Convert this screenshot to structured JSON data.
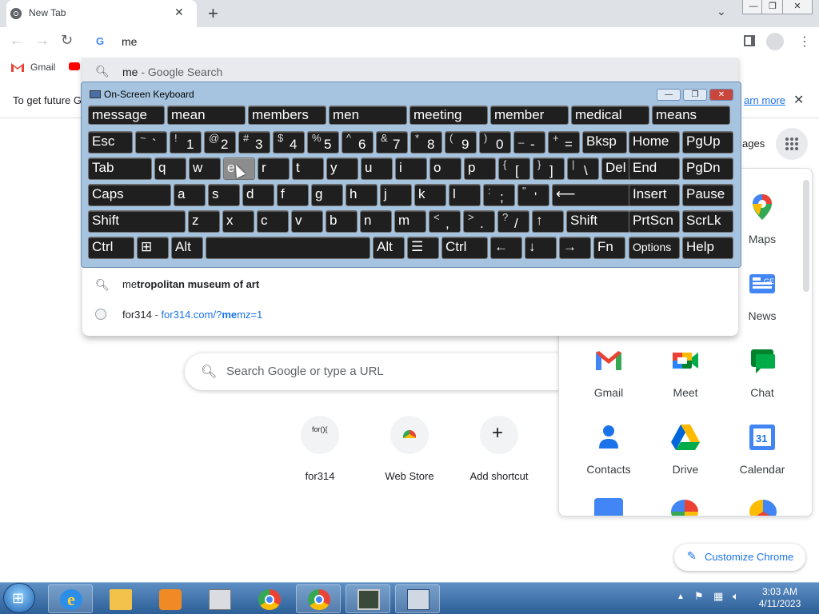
{
  "browser": {
    "tab_title": "New Tab",
    "tab_close": "✕",
    "new_tab": "+",
    "omnibox_value": "me",
    "bookmark_gmail": "Gmail"
  },
  "window_controls": {
    "minimize": "—",
    "restore": "❐",
    "close": "✕"
  },
  "infobar": {
    "text": "To get future G",
    "learn_more": "arn more",
    "close": "✕"
  },
  "dropdown": {
    "top_suggestion": "me",
    "top_suggestion_suffix": " - Google Search",
    "suggestions": [
      {
        "prefix": "me",
        "rest": "tropolitan museum of art"
      },
      {
        "site": "for314",
        "sep": " - ",
        "url_pre": "for314.com/?",
        "url_bold": "me",
        "url_post": "mz=1"
      }
    ]
  },
  "osk": {
    "title": "On-Screen Keyboard",
    "predictions": [
      "message",
      "mean",
      "members",
      "men",
      "meeting",
      "member",
      "medical",
      "means"
    ],
    "rows": [
      [
        {
          "l": "Esc",
          "w": 56
        },
        {
          "s": "~",
          "m": "`",
          "w": 40
        },
        {
          "s": "!",
          "m": "1",
          "w": 40
        },
        {
          "s": "@",
          "m": "2",
          "w": 40
        },
        {
          "s": "#",
          "m": "3",
          "w": 40
        },
        {
          "s": "$",
          "m": "4",
          "w": 40
        },
        {
          "s": "%",
          "m": "5",
          "w": 40
        },
        {
          "s": "^",
          "m": "6",
          "w": 40
        },
        {
          "s": "&",
          "m": "7",
          "w": 40
        },
        {
          "s": "*",
          "m": "8",
          "w": 40
        },
        {
          "s": "(",
          "m": "9",
          "w": 40
        },
        {
          "s": ")",
          "m": "0",
          "w": 40
        },
        {
          "s": "_",
          "m": "-",
          "w": 40
        },
        {
          "s": "+",
          "m": "=",
          "w": 40
        },
        {
          "l": "Bksp",
          "w": 56
        },
        {
          "l": "Home",
          "w": 64
        },
        {
          "l": "PgUp",
          "w": 64
        }
      ],
      [
        {
          "l": "Tab",
          "w": 80
        },
        {
          "l": "q",
          "w": 40
        },
        {
          "l": "w",
          "w": 40
        },
        {
          "l": "e",
          "w": 40,
          "hover": true
        },
        {
          "l": "r",
          "w": 40
        },
        {
          "l": "t",
          "w": 40
        },
        {
          "l": "y",
          "w": 40
        },
        {
          "l": "u",
          "w": 40
        },
        {
          "l": "i",
          "w": 40
        },
        {
          "l": "o",
          "w": 40
        },
        {
          "l": "p",
          "w": 40
        },
        {
          "s": "{",
          "m": "[",
          "w": 40
        },
        {
          "s": "}",
          "m": "]",
          "w": 40
        },
        {
          "s": "|",
          "m": "\\",
          "w": 40
        },
        {
          "l": "Del",
          "w": 40
        },
        {
          "l": "End",
          "w": 64
        },
        {
          "l": "PgDn",
          "w": 64
        }
      ],
      [
        {
          "l": "Caps",
          "w": 104
        },
        {
          "l": "a",
          "w": 40
        },
        {
          "l": "s",
          "w": 40
        },
        {
          "l": "d",
          "w": 40
        },
        {
          "l": "f",
          "w": 40
        },
        {
          "l": "g",
          "w": 40
        },
        {
          "l": "h",
          "w": 40
        },
        {
          "l": "j",
          "w": 40
        },
        {
          "l": "k",
          "w": 40
        },
        {
          "l": "l",
          "w": 40
        },
        {
          "s": ":",
          "m": ";",
          "w": 40
        },
        {
          "s": "\"",
          "m": "'",
          "w": 40
        },
        {
          "l": "⟵",
          "w": 104
        },
        {
          "l": "Insert",
          "w": 64
        },
        {
          "l": "Pause",
          "w": 64
        }
      ],
      [
        {
          "l": "Shift",
          "w": 122
        },
        {
          "l": "z",
          "w": 40
        },
        {
          "l": "x",
          "w": 40
        },
        {
          "l": "c",
          "w": 40
        },
        {
          "l": "v",
          "w": 40
        },
        {
          "l": "b",
          "w": 40
        },
        {
          "l": "n",
          "w": 40
        },
        {
          "l": "m",
          "w": 40
        },
        {
          "s": "<",
          "m": ",",
          "w": 40
        },
        {
          "s": ">",
          "m": ".",
          "w": 40
        },
        {
          "s": "?",
          "m": "/",
          "w": 40
        },
        {
          "l": "↑",
          "w": 40
        },
        {
          "l": "Shift",
          "w": 80
        },
        {
          "l": "PrtScn",
          "w": 64
        },
        {
          "l": "ScrLk",
          "w": 64
        }
      ],
      [
        {
          "l": "Ctrl",
          "w": 58
        },
        {
          "l": "⊞",
          "w": 40
        },
        {
          "l": "Alt",
          "w": 40
        },
        {
          "l": "",
          "w": 206
        },
        {
          "l": "Alt",
          "w": 40
        },
        {
          "l": "☰",
          "w": 40
        },
        {
          "l": "Ctrl",
          "w": 58
        },
        {
          "l": "←",
          "w": 40
        },
        {
          "l": "↓",
          "w": 40
        },
        {
          "l": "→",
          "w": 40
        },
        {
          "l": "Fn",
          "w": 40
        },
        {
          "l": "Options",
          "w": 64,
          "small": true
        },
        {
          "l": "Help",
          "w": 64
        }
      ]
    ]
  },
  "ntp": {
    "search_placeholder": "Search Google or type a URL",
    "images_label": "ages",
    "shortcuts": [
      {
        "label": "for314",
        "icon": "for(){"
      },
      {
        "label": "Web Store",
        "icon": ""
      },
      {
        "label": "Add shortcut",
        "icon": "+"
      }
    ],
    "customize": "Customize Chrome"
  },
  "apps": [
    {
      "label": "Maps",
      "icon": "maps-icon"
    },
    {
      "label": "News",
      "icon": "news-icon"
    },
    {
      "label": "Gmail",
      "icon": "gmail-icon"
    },
    {
      "label": "Meet",
      "icon": "meet-icon"
    },
    {
      "label": "Chat",
      "icon": "chat-icon"
    },
    {
      "label": "Contacts",
      "icon": "contacts-icon"
    },
    {
      "label": "Drive",
      "icon": "drive-icon"
    },
    {
      "label": "Calendar",
      "icon": "calendar-icon",
      "text": "31"
    }
  ],
  "taskbar": {
    "time": "3:03 AM",
    "date": "4/11/2023"
  }
}
